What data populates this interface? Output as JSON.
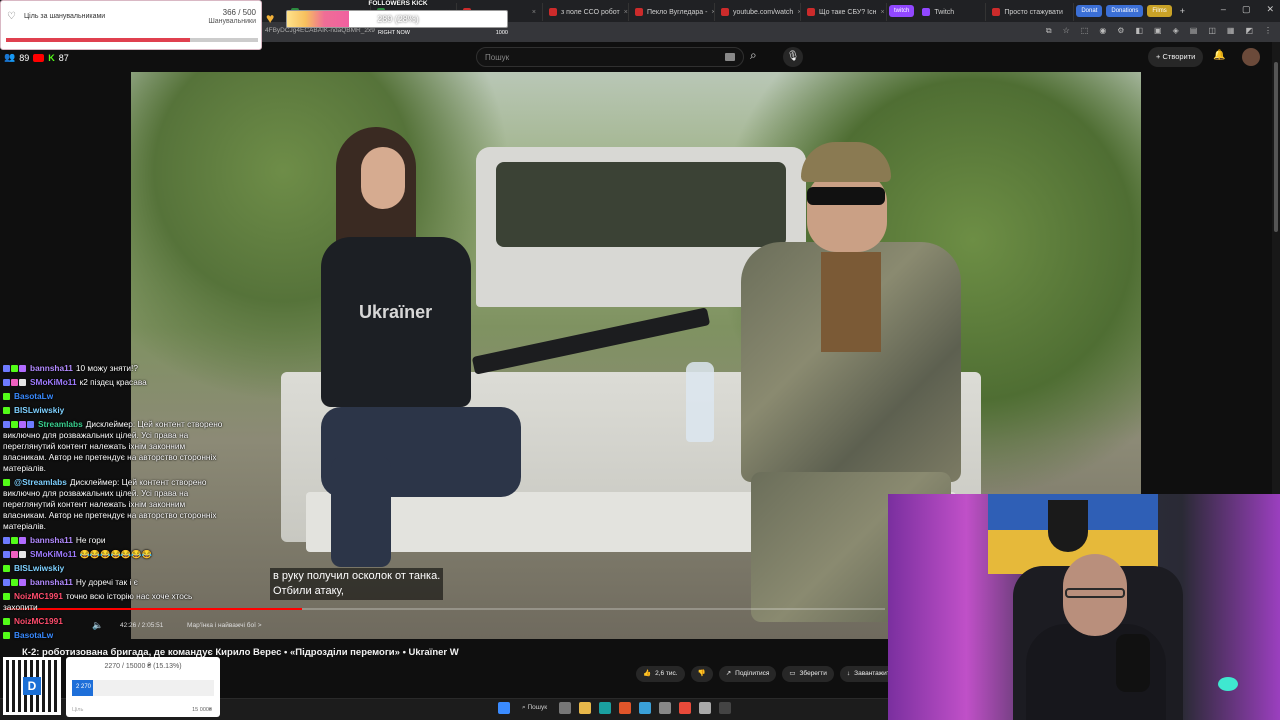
{
  "browser": {
    "tabs": [
      {
        "label": "",
        "color": "#2c8c3f"
      },
      {
        "label": "",
        "color": "#2c8c3f"
      },
      {
        "label": "",
        "color": "#cc2b2b"
      },
      {
        "label": "з поле ССО робот",
        "color": "#cc2b2b"
      },
      {
        "label": "Пекло Вугледара -",
        "color": "#cc2b2b"
      },
      {
        "label": "youtube.com/watch",
        "color": "#cc2b2b"
      },
      {
        "label": "Що таке СБУ? Існ",
        "color": "#cc2b2b"
      }
    ],
    "pill_tabs": [
      "twitch",
      "Twitch"
    ],
    "tabs_right": [
      "Просто стажувати",
      "Donat",
      "Donations",
      "Films"
    ],
    "new_tab": "+",
    "window_controls": [
      "–",
      "▢",
      "✕"
    ],
    "url": "4FByDCJg4ECABAIK-ndaQBMR_2x9"
  },
  "youtube": {
    "search_placeholder": "Пошук",
    "create_label": "+ Створити",
    "video_title": "К-2: роботизована бригада, де командує Кирило Верес • «Підрозділи перемоги» • Ukraїner W",
    "time": "42:26 / 2:05:51",
    "chapter": "Мар'їнка і найважчі бої  >",
    "progress_fraction": 0.338,
    "actions": {
      "like": "2,6 тис.",
      "share": "Поділитися",
      "save": "Зберегти",
      "download": "Завантажити"
    },
    "subtitles": [
      "в руку получил осколок от танка.",
      "Отбили атаку,"
    ]
  },
  "video_scene": {
    "shirt_text": "Ukraїner"
  },
  "overlays": {
    "goal": {
      "label": "Ціль за шанувальниками",
      "count": "366 / 500",
      "unit": "Шанувальники",
      "fraction": 0.732
    },
    "followers_kick": {
      "title": "FOLLOWERS KICK",
      "value": "289 (28%)",
      "now_label": "RIGHT NOW",
      "max": "1000",
      "fraction": 0.28
    },
    "channel_badges": {
      "yt_count": "89",
      "kick_count": "87"
    },
    "donation_goal": {
      "text": "2270 / 15000 ₴ (15.13%)",
      "value_label": "2 270",
      "min_label": "Ціль",
      "max_label": "15 000₴",
      "fraction": 0.1513,
      "qr_letter": "D"
    }
  },
  "chat": [
    {
      "user": "bannsha11",
      "color": "#b38bff",
      "text": "10 можу зняти!?",
      "badges": [
        "#6e7bff",
        "#53fc18",
        "#b16bff"
      ]
    },
    {
      "user": "SMoKiMo11",
      "color": "#9f7bff",
      "text": "к2 піздєц красава",
      "badges": [
        "#6e7bff",
        "#f060c0",
        "#e6e6e6"
      ]
    },
    {
      "user": "BasotaLw",
      "color": "#3a8bff",
      "text": "",
      "badges": [
        "#53fc18"
      ]
    },
    {
      "user": "BISLwiwskiy",
      "color": "#7fd1ff",
      "text": "",
      "badges": [
        "#53fc18"
      ]
    },
    {
      "user": "Streamlabs",
      "color": "#3ad08f",
      "text": "Дисклеймер: Цей контент створено виключно для розважальних цілей. Усі права на переглянутий контент належать іхнім законним власникам. Автор не претендує на авторство сторонніх матеріалів.",
      "badges": [
        "#6e7bff",
        "#53fc18",
        "#b16bff",
        "#6e7bff"
      ]
    },
    {
      "user": "@Streamlabs",
      "color": "#7fd1ff",
      "text": "Дисклеймер: Цей контент створено виключно для розважальних цілей. Усі права на переглянутий контент належать іхнім законним власникам. Автор не претендує на авторство сторонніх матеріалів.",
      "badges": [
        "#53fc18"
      ]
    },
    {
      "user": "bannsha11",
      "color": "#b38bff",
      "text": "Не гори",
      "badges": [
        "#6e7bff",
        "#53fc18",
        "#b16bff"
      ]
    },
    {
      "user": "SMoKiMo11",
      "color": "#9f7bff",
      "text": "😂😂😂😂😂😂😂",
      "badges": [
        "#6e7bff",
        "#f060c0",
        "#e6e6e6"
      ]
    },
    {
      "user": "BISLwiwskiy",
      "color": "#7fd1ff",
      "text": "",
      "badges": [
        "#53fc18"
      ]
    },
    {
      "user": "bannsha11",
      "color": "#b38bff",
      "text": "Ну доречі так і є",
      "badges": [
        "#6e7bff",
        "#53fc18",
        "#b16bff"
      ]
    },
    {
      "user": "NoizMC1991",
      "color": "#ff4d6d",
      "text": "точно всю історію нас хоче хтось захопити",
      "badges": [
        "#53fc18"
      ]
    },
    {
      "user": "NoizMC1991",
      "color": "#ff4d6d",
      "text": "",
      "badges": [
        "#53fc18"
      ]
    },
    {
      "user": "BasotaLw",
      "color": "#3a8bff",
      "text": "",
      "badges": [
        "#53fc18"
      ]
    }
  ],
  "taskbar": {
    "search": "Пошук"
  }
}
